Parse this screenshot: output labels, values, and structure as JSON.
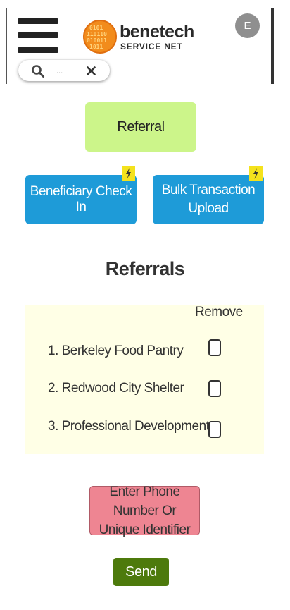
{
  "header": {
    "brand_name": "benetech",
    "brand_sub": "SERVICE NET",
    "avatar_initial": "E",
    "search": {
      "value": "",
      "placeholder": "..."
    }
  },
  "actions": {
    "referral_label": "Referral",
    "checkin_label": "Beneficiary Check In",
    "bulk_label": "Bulk Transaction Upload"
  },
  "referrals": {
    "heading": "Referrals",
    "remove_label": "Remove",
    "items": [
      {
        "label": "1. Berkeley Food Pantry",
        "checked": false
      },
      {
        "label": "2. Redwood City Shelter",
        "checked": false
      },
      {
        "label": "3. Professional Development",
        "checked": false
      }
    ]
  },
  "footer": {
    "phone_label": "Enter Phone Number Or Unique Identifier",
    "send_label": "Send"
  },
  "colors": {
    "referral_btn": "#ccf58a",
    "primary_btn": "#1e9bd8",
    "bolt_badge": "#f4e21d",
    "panel_bg": "#ffffe6",
    "phone_btn": "#ee8592",
    "send_btn": "#4d7a0c",
    "logo_orange": "#f28c1c"
  },
  "icons": [
    "hamburger-menu-icon",
    "search-icon",
    "close-icon",
    "lightning-bolt-icon"
  ]
}
